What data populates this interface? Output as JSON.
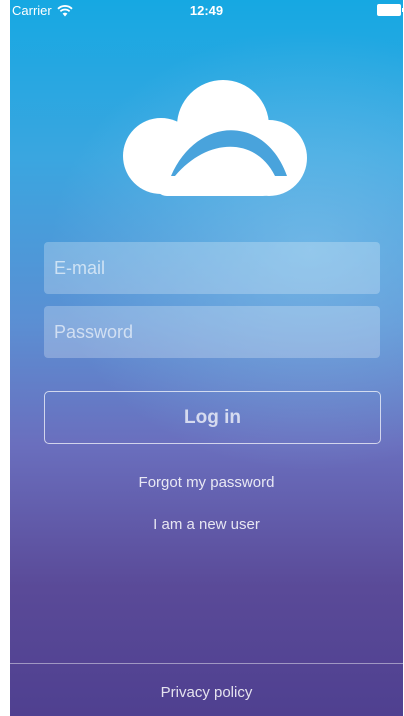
{
  "status_bar": {
    "carrier": "Carrier",
    "time": "12:49",
    "wifi_icon": "wifi-icon",
    "battery_icon": "battery-icon"
  },
  "logo": {
    "icon": "cloud-logo-icon"
  },
  "form": {
    "email_placeholder": "E-mail",
    "email_value": "",
    "password_placeholder": "Password",
    "password_value": "",
    "login_label": "Log in"
  },
  "links": {
    "forgot_password": "Forgot my password",
    "new_user": "I am a new user"
  },
  "footer": {
    "privacy_policy": "Privacy policy"
  },
  "colors": {
    "gradient_top": "#16a8e2",
    "gradient_bottom": "#4f4090",
    "text": "#ffffff"
  }
}
